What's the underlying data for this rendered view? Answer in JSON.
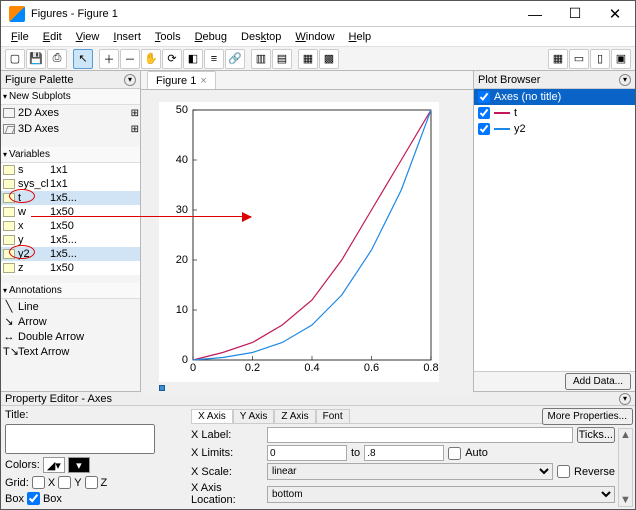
{
  "window": {
    "title": "Figures - Figure 1"
  },
  "menu": [
    "File",
    "Edit",
    "View",
    "Insert",
    "Tools",
    "Debug",
    "Desktop",
    "Window",
    "Help"
  ],
  "figure_palette": {
    "title": "Figure Palette",
    "new_subplots": "New Subplots",
    "axes2d": "2D Axes",
    "axes3d": "3D Axes",
    "variables": "Variables",
    "vars": [
      {
        "name": "s",
        "size": "1x1"
      },
      {
        "name": "sys_cl",
        "size": "1x1"
      },
      {
        "name": "t",
        "size": "1x5..."
      },
      {
        "name": "w",
        "size": "1x50"
      },
      {
        "name": "x",
        "size": "1x50"
      },
      {
        "name": "y",
        "size": "1x5..."
      },
      {
        "name": "y2",
        "size": "1x5..."
      },
      {
        "name": "z",
        "size": "1x50"
      }
    ],
    "annotations": "Annotations",
    "ann_items": [
      "Line",
      "Arrow",
      "Double Arrow",
      "Text Arrow"
    ]
  },
  "tab": {
    "label": "Figure 1"
  },
  "plot_browser": {
    "title": "Plot Browser",
    "axes_label": "Axes (no title)",
    "series": [
      {
        "name": "t",
        "color": "#c2185b"
      },
      {
        "name": "y2",
        "color": "#1e88e5"
      }
    ],
    "add_data": "Add Data..."
  },
  "prop_editor": {
    "title": "Property Editor - Axes",
    "title_lbl": "Title:",
    "colors_lbl": "Colors:",
    "grid_lbl": "Grid:",
    "box_lbl": "Box",
    "box_checked_lbl": "Box",
    "tabs": [
      "X Axis",
      "Y Axis",
      "Z Axis",
      "Font"
    ],
    "xlabel_lbl": "X Label:",
    "ticks_btn": "Ticks...",
    "xlimits_lbl": "X Limits:",
    "xlim_lo": "0",
    "xlim_to": "to",
    "xlim_hi": ".8",
    "auto_lbl": "Auto",
    "xscale_lbl": "X Scale:",
    "xscale_val": "linear",
    "reverse_lbl": "Reverse",
    "xaxloc_lbl": "X Axis Location:",
    "xaxloc_val": "bottom",
    "more": "More Properties...",
    "grid_x": "X",
    "grid_y": "Y",
    "grid_z": "Z"
  },
  "chart_data": {
    "type": "line",
    "title": "",
    "xlabel": "",
    "ylabel": "",
    "xlim": [
      0,
      0.8
    ],
    "ylim": [
      0,
      50
    ],
    "xticks": [
      0,
      0.2,
      0.4,
      0.6,
      0.8
    ],
    "yticks": [
      0,
      10,
      20,
      30,
      40,
      50
    ],
    "series": [
      {
        "name": "t",
        "color": "#c2185b",
        "x": [
          0,
          0.1,
          0.2,
          0.3,
          0.4,
          0.5,
          0.6,
          0.7,
          0.8
        ],
        "y": [
          0,
          1.5,
          3.5,
          7,
          12,
          20,
          30,
          40,
          50
        ]
      },
      {
        "name": "y2",
        "color": "#1e88e5",
        "x": [
          0,
          0.1,
          0.2,
          0.3,
          0.4,
          0.5,
          0.6,
          0.7,
          0.8
        ],
        "y": [
          0,
          0.5,
          1.5,
          3.5,
          7,
          13,
          22,
          34,
          50
        ]
      }
    ]
  }
}
